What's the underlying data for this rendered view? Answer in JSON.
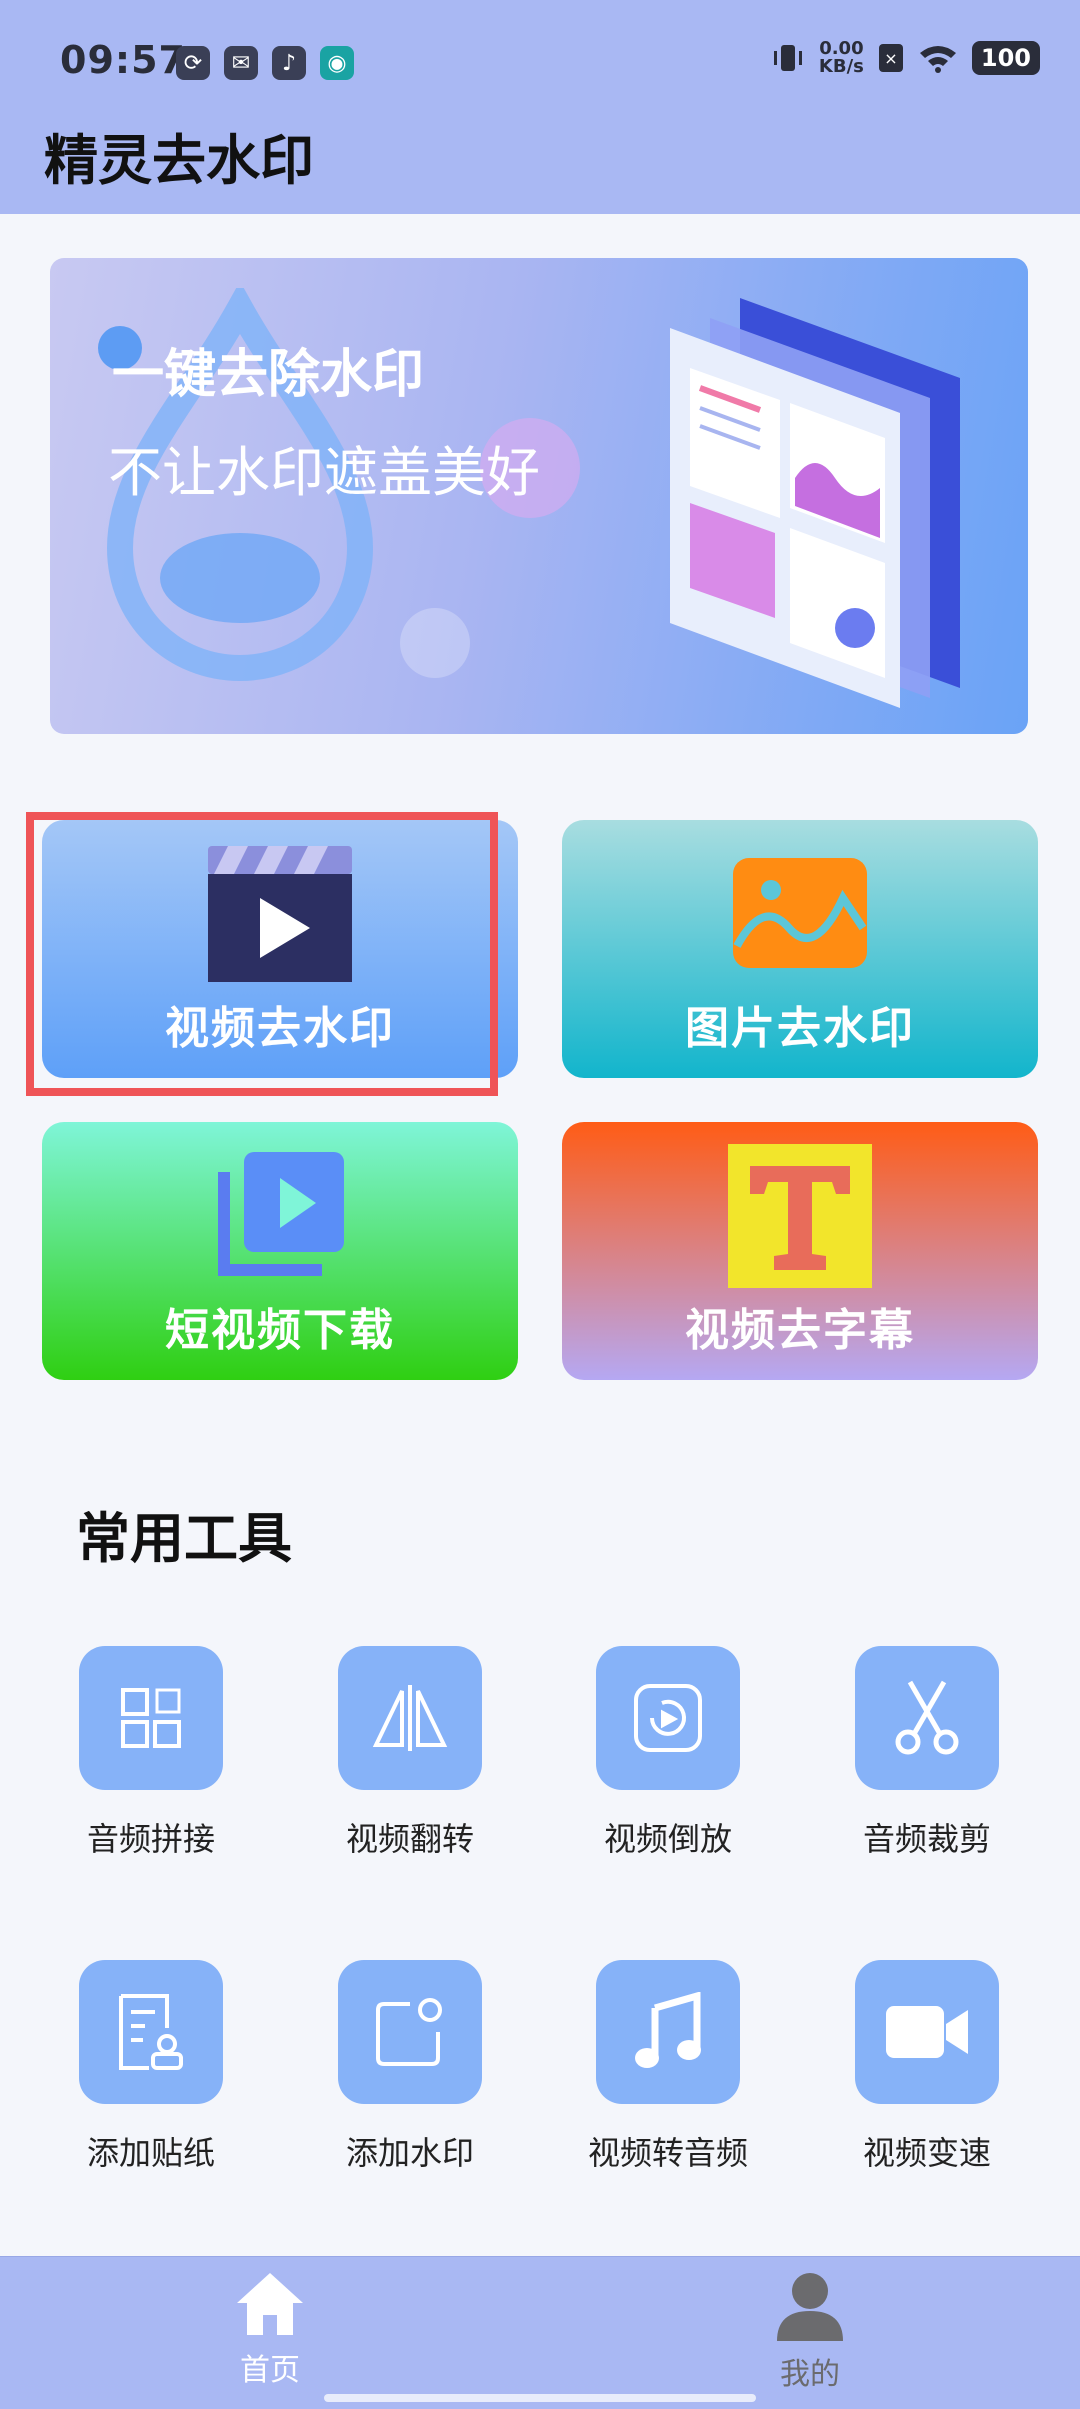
{
  "status_bar": {
    "time": "09:57",
    "net_speed_value": "0.00",
    "net_speed_unit": "KB/s",
    "battery": "100",
    "notification_icons": [
      "sync-icon",
      "message-icon",
      "tiktok-icon",
      "app-icon"
    ]
  },
  "header": {
    "title": "精灵去水印"
  },
  "banner": {
    "headline": "一键去除水印",
    "subline": "不让水印遮盖美好"
  },
  "features": [
    {
      "label": "视频去水印",
      "icon": "video-clapper-icon"
    },
    {
      "label": "图片去水印",
      "icon": "image-icon"
    },
    {
      "label": "短视频下载",
      "icon": "video-download-icon"
    },
    {
      "label": "视频去字幕",
      "icon": "text-t-icon"
    }
  ],
  "tools_section": {
    "title": "常用工具",
    "items": [
      {
        "label": "音频拼接",
        "icon": "grid-icon"
      },
      {
        "label": "视频翻转",
        "icon": "flip-icon"
      },
      {
        "label": "视频倒放",
        "icon": "rewind-icon"
      },
      {
        "label": "音频裁剪",
        "icon": "scissors-icon"
      },
      {
        "label": "添加贴纸",
        "icon": "sticker-icon"
      },
      {
        "label": "添加水印",
        "icon": "watermark-icon"
      },
      {
        "label": "视频转音频",
        "icon": "music-icon"
      },
      {
        "label": "视频变速",
        "icon": "camera-icon"
      }
    ]
  },
  "tabbar": {
    "home": "首页",
    "mine": "我的"
  },
  "colors": {
    "header_bg": "#a9b8f3",
    "tool_icon_bg": "#86b2f8",
    "highlight": "#ef5457"
  }
}
